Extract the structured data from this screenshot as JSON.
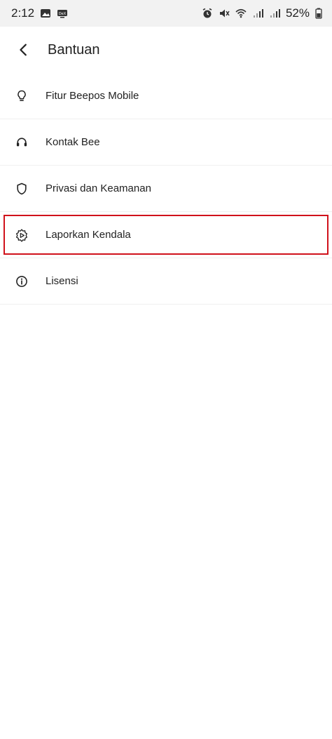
{
  "status_bar": {
    "time": "2:12",
    "battery": "52%",
    "icons": [
      "gallery-icon",
      "dex-icon",
      "alarm-icon",
      "mute-icon",
      "wifi-icon",
      "signal-icon",
      "signal-icon",
      "battery-icon"
    ]
  },
  "header": {
    "title": "Bantuan",
    "back_icon": "arrow-back-icon"
  },
  "menu": {
    "items": [
      {
        "label": "Fitur Beepos Mobile",
        "icon": "lightbulb-icon"
      },
      {
        "label": "Kontak Bee",
        "icon": "headset-icon"
      },
      {
        "label": "Privasi dan Keamanan",
        "icon": "shield-icon"
      },
      {
        "label": "Laporkan Kendala",
        "icon": "report-icon",
        "highlighted": true
      },
      {
        "label": "Lisensi",
        "icon": "info-icon"
      }
    ]
  },
  "colors": {
    "highlight": "#d0121b",
    "status_bar_bg": "#f2f2f2",
    "text": "#222222"
  }
}
